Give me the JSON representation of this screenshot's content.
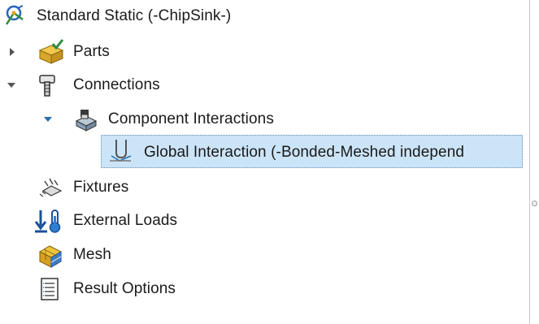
{
  "tree": {
    "root": {
      "label": "Standard Static (-ChipSink-)",
      "icon": "study-icon"
    },
    "items": [
      {
        "label": "Parts",
        "icon": "parts-icon",
        "state": "collapsed"
      },
      {
        "label": "Connections",
        "icon": "connections-icon",
        "state": "expanded"
      },
      {
        "label": "Component Interactions",
        "icon": "component-interactions-icon",
        "state": "expanded"
      },
      {
        "label": "Global Interaction (-Bonded-Meshed independ",
        "icon": "global-interaction-icon",
        "selected": true
      },
      {
        "label": "Fixtures",
        "icon": "fixtures-icon"
      },
      {
        "label": "External Loads",
        "icon": "external-loads-icon"
      },
      {
        "label": "Mesh",
        "icon": "mesh-icon"
      },
      {
        "label": "Result Options",
        "icon": "result-options-icon"
      }
    ]
  },
  "colors": {
    "selection": "#cce4f7",
    "selection_border": "#6a8fb3",
    "expander": "#555555",
    "expander_active": "#2a6fb0"
  }
}
